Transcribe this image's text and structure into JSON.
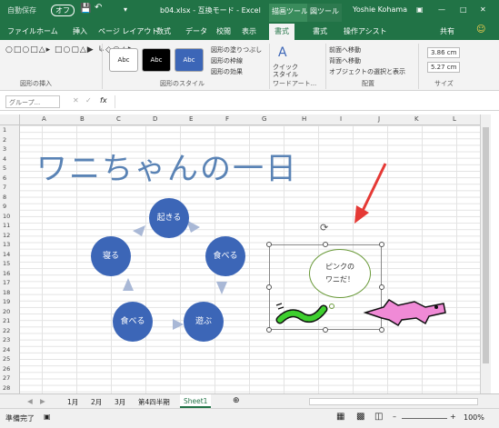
{
  "titlebar": {
    "autosave": "自動保存",
    "autosave_state": "オフ",
    "filename": "b04.xlsx - 互換モード - Excel",
    "ctx1": "描画ツール",
    "ctx2": "図ツール",
    "user": "Yoshie Kohama"
  },
  "tabs": [
    {
      "label": "ファイル"
    },
    {
      "label": "ホーム"
    },
    {
      "label": "挿入"
    },
    {
      "label": "ページ レイアウト"
    },
    {
      "label": "数式"
    },
    {
      "label": "データ"
    },
    {
      "label": "校閲"
    },
    {
      "label": "表示"
    },
    {
      "label": "書式"
    },
    {
      "label": "書式"
    },
    {
      "label": "操作アシスト"
    },
    {
      "label": "共有"
    }
  ],
  "ribbon": {
    "group_insert": "図形の挿入",
    "group_style": "図形のスタイル",
    "group_wordart": "ワードアート...",
    "group_arrange": "配置",
    "group_size": "サイズ",
    "style1": "Abc",
    "style2": "Abc",
    "style3": "Abc",
    "fill": "図形の塗りつぶし",
    "outline": "図形の枠線",
    "effect": "図形の効果",
    "quick_style": "クイック\nスタイル",
    "front": "前面へ移動",
    "back": "背面へ移動",
    "select_pane": "オブジェクトの選択と表示",
    "height": "3.86 cm",
    "width": "5.27 cm"
  },
  "formula": {
    "namebox": "グループ...",
    "fx": "fx"
  },
  "columns": [
    "A",
    "B",
    "C",
    "D",
    "E",
    "F",
    "G",
    "H",
    "I",
    "J",
    "K",
    "L"
  ],
  "rows": [
    "1",
    "2",
    "3",
    "4",
    "5",
    "6",
    "7",
    "8",
    "9",
    "10",
    "11",
    "12",
    "13",
    "14",
    "15",
    "16",
    "17",
    "18",
    "19",
    "20",
    "21",
    "22",
    "23",
    "24",
    "25",
    "26",
    "27",
    "28"
  ],
  "content": {
    "title": "ワニちゃんの一日",
    "cycle": [
      "起きる",
      "食べる",
      "遊ぶ",
      "食べる",
      "寝る"
    ],
    "bubble_line1": "ピンクの",
    "bubble_line2": "ワニだ！"
  },
  "sheets": [
    "1月",
    "2月",
    "3月",
    "第4四半期",
    "Sheet1"
  ],
  "status": {
    "ready": "準備完了",
    "zoom": "100%"
  },
  "colors": {
    "excel_green": "#217346",
    "circle_blue": "#3c66b7",
    "arrow_red": "#e53935"
  }
}
